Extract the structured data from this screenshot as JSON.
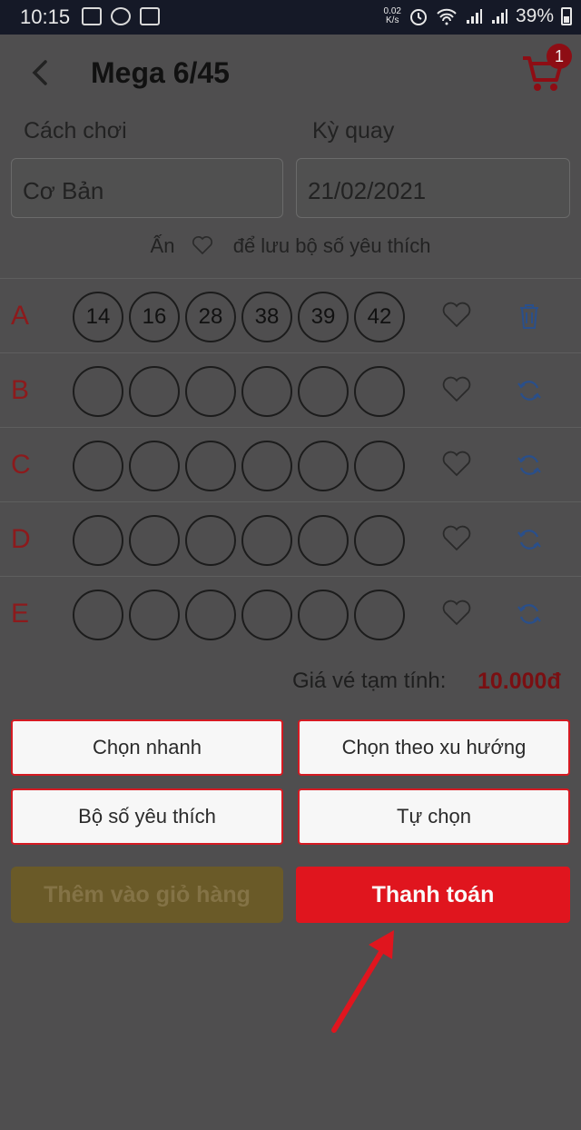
{
  "status_bar": {
    "time": "10:15",
    "speed_top": "0.02",
    "speed_bottom": "K/s",
    "battery": "39%"
  },
  "header": {
    "title": "Mega 6/45",
    "cart_count": "1"
  },
  "form": {
    "play_label": "Cách chơi",
    "draw_label": "Kỳ quay",
    "play_value": "Cơ Bản",
    "draw_value": "21/02/2021"
  },
  "hint": {
    "before": "Ấn",
    "after": "để lưu bộ số yêu thích"
  },
  "rows": [
    {
      "letter": "A",
      "numbers": [
        "14",
        "16",
        "28",
        "38",
        "39",
        "42"
      ],
      "action": "trash-icon"
    },
    {
      "letter": "B",
      "numbers": [
        "",
        "",
        "",
        "",
        "",
        ""
      ],
      "action": "refresh-icon"
    },
    {
      "letter": "C",
      "numbers": [
        "",
        "",
        "",
        "",
        "",
        ""
      ],
      "action": "refresh-icon"
    },
    {
      "letter": "D",
      "numbers": [
        "",
        "",
        "",
        "",
        "",
        ""
      ],
      "action": "refresh-icon"
    },
    {
      "letter": "E",
      "numbers": [
        "",
        "",
        "",
        "",
        "",
        ""
      ],
      "action": "refresh-icon"
    }
  ],
  "price": {
    "label": "Giá vé tạm tính:",
    "value": "10.000đ"
  },
  "options": {
    "quick_pick": "Chọn nhanh",
    "trend_pick": "Chọn theo xu hướng",
    "favorites": "Bộ số yêu thích",
    "self_pick": "Tự chọn"
  },
  "actions": {
    "add_to_cart": "Thêm vào giỏ hàng",
    "checkout": "Thanh toán"
  },
  "colors": {
    "accent_red": "#e0151e",
    "letter_red": "#8c1a1c",
    "overlay": "#4f4e4f",
    "refresh_blue": "#2a4f8a"
  }
}
